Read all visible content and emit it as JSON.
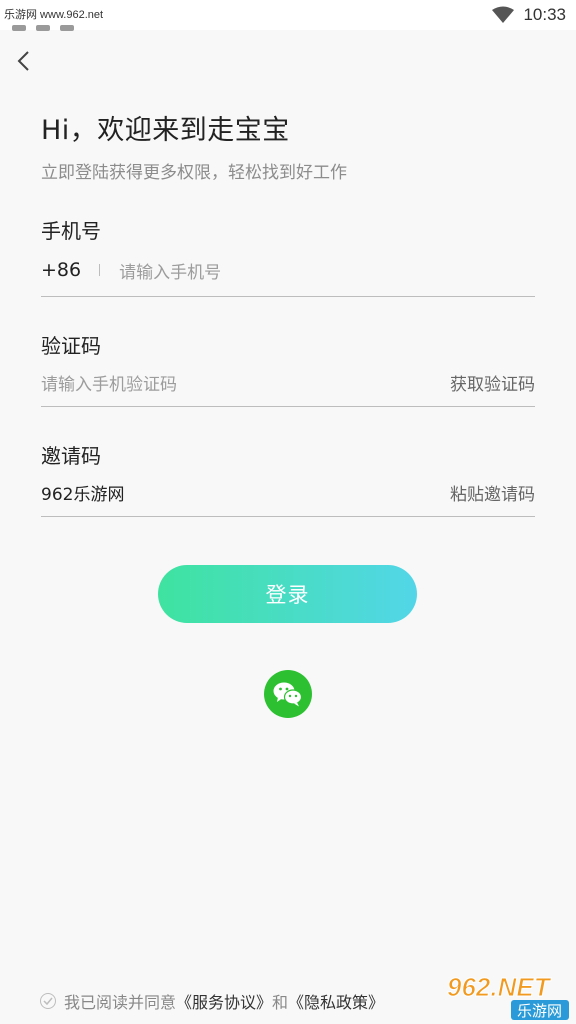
{
  "status_bar": {
    "watermark": "乐游网 www.962.net",
    "time": "10:33"
  },
  "header": {
    "title": "Hi，欢迎来到走宝宝",
    "subtitle": "立即登陆获得更多权限，轻松找到好工作"
  },
  "phone": {
    "label": "手机号",
    "country_code": "+86",
    "placeholder": "请输入手机号"
  },
  "code": {
    "label": "验证码",
    "placeholder": "请输入手机验证码",
    "action": "获取验证码"
  },
  "invite": {
    "label": "邀请码",
    "value": "962乐游网",
    "action": "粘贴邀请码"
  },
  "login_button": "登录",
  "agreement": {
    "prefix": "我已阅读并同意",
    "service_link": "《服务协议》",
    "and": "和",
    "privacy_link": "《隐私政策》"
  },
  "brand": {
    "big": "962.NET",
    "small": "乐游网"
  },
  "colors": {
    "button_gradient_start": "#3fe3a0",
    "button_gradient_end": "#52d6e8",
    "wechat_green": "#2dc132"
  },
  "icons": [
    "back-arrow-icon",
    "wifi-icon",
    "wechat-icon",
    "check-circle-icon"
  ]
}
